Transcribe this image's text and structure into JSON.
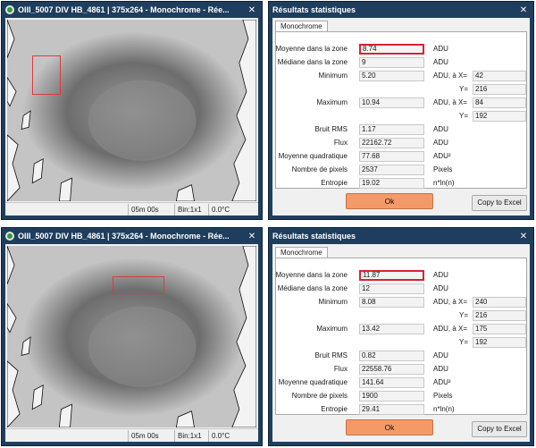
{
  "viewers": [
    {
      "title": "OIII_5007 DIV HB_4861 | 375x264 - Monochrome - Rée...",
      "close": "✕",
      "status": {
        "exposure": "05m 00s",
        "bin": "Bin:1x1",
        "temp": "0.0°C"
      }
    },
    {
      "title": "OIII_5007 DIV HB_4861 | 375x264 - Monochrome - Rée...",
      "close": "✕",
      "status": {
        "exposure": "05m 00s",
        "bin": "Bin:1x1",
        "temp": "0.0°C"
      }
    }
  ],
  "stats": [
    {
      "title": "Résultats statistiques",
      "close": "✕",
      "tab": "Monochrome",
      "rows": {
        "mean": {
          "label": "Moyenne dans la zone",
          "value": "8.74",
          "unit": "ADU"
        },
        "median": {
          "label": "Médiane dans la zone",
          "value": "9",
          "unit": "ADU"
        },
        "min": {
          "label": "Minimum",
          "value": "5.20",
          "unit": "ADU, à X=",
          "x": "42",
          "ylabel": "Y=",
          "y": "216"
        },
        "max": {
          "label": "Maximum",
          "value": "10.94",
          "unit": "ADU, à X=",
          "x": "84",
          "ylabel": "Y=",
          "y": "192"
        },
        "rms": {
          "label": "Bruit RMS",
          "value": "1.17",
          "unit": "ADU"
        },
        "flux": {
          "label": "Flux",
          "value": "22162.72",
          "unit": "ADU"
        },
        "quad": {
          "label": "Moyenne quadratique",
          "value": "77.68",
          "unit": "ADU²"
        },
        "pixels": {
          "label": "Nombre de pixels",
          "value": "2537",
          "unit": "Pixels"
        },
        "entropy": {
          "label": "Entropie",
          "value": "19.02",
          "unit": "n*ln(n)"
        }
      },
      "ok": "Ok",
      "excel": "Copy to Excel"
    },
    {
      "title": "Résultats statistiques",
      "close": "✕",
      "tab": "Monochrome",
      "rows": {
        "mean": {
          "label": "Moyenne dans la zone",
          "value": "11.87",
          "unit": "ADU"
        },
        "median": {
          "label": "Médiane dans la zone",
          "value": "12",
          "unit": "ADU"
        },
        "min": {
          "label": "Minimum",
          "value": "8.08",
          "unit": "ADU, à X=",
          "x": "240",
          "ylabel": "Y=",
          "y": "216"
        },
        "max": {
          "label": "Maximum",
          "value": "13.42",
          "unit": "ADU, à X=",
          "x": "175",
          "ylabel": "Y=",
          "y": "192"
        },
        "rms": {
          "label": "Bruit RMS",
          "value": "0.82",
          "unit": "ADU"
        },
        "flux": {
          "label": "Flux",
          "value": "22558.76",
          "unit": "ADU"
        },
        "quad": {
          "label": "Moyenne quadratique",
          "value": "141.64",
          "unit": "ADU²"
        },
        "pixels": {
          "label": "Nombre de pixels",
          "value": "1900",
          "unit": "Pixels"
        },
        "entropy": {
          "label": "Entropie",
          "value": "29.41",
          "unit": "n*ln(n)"
        }
      },
      "ok": "Ok",
      "excel": "Copy to Excel"
    }
  ],
  "colors": {
    "titlebar": "#1f3d5c",
    "ok_button": "#f39a68",
    "highlight": "#d9232e",
    "roi": "#e03a3a"
  }
}
